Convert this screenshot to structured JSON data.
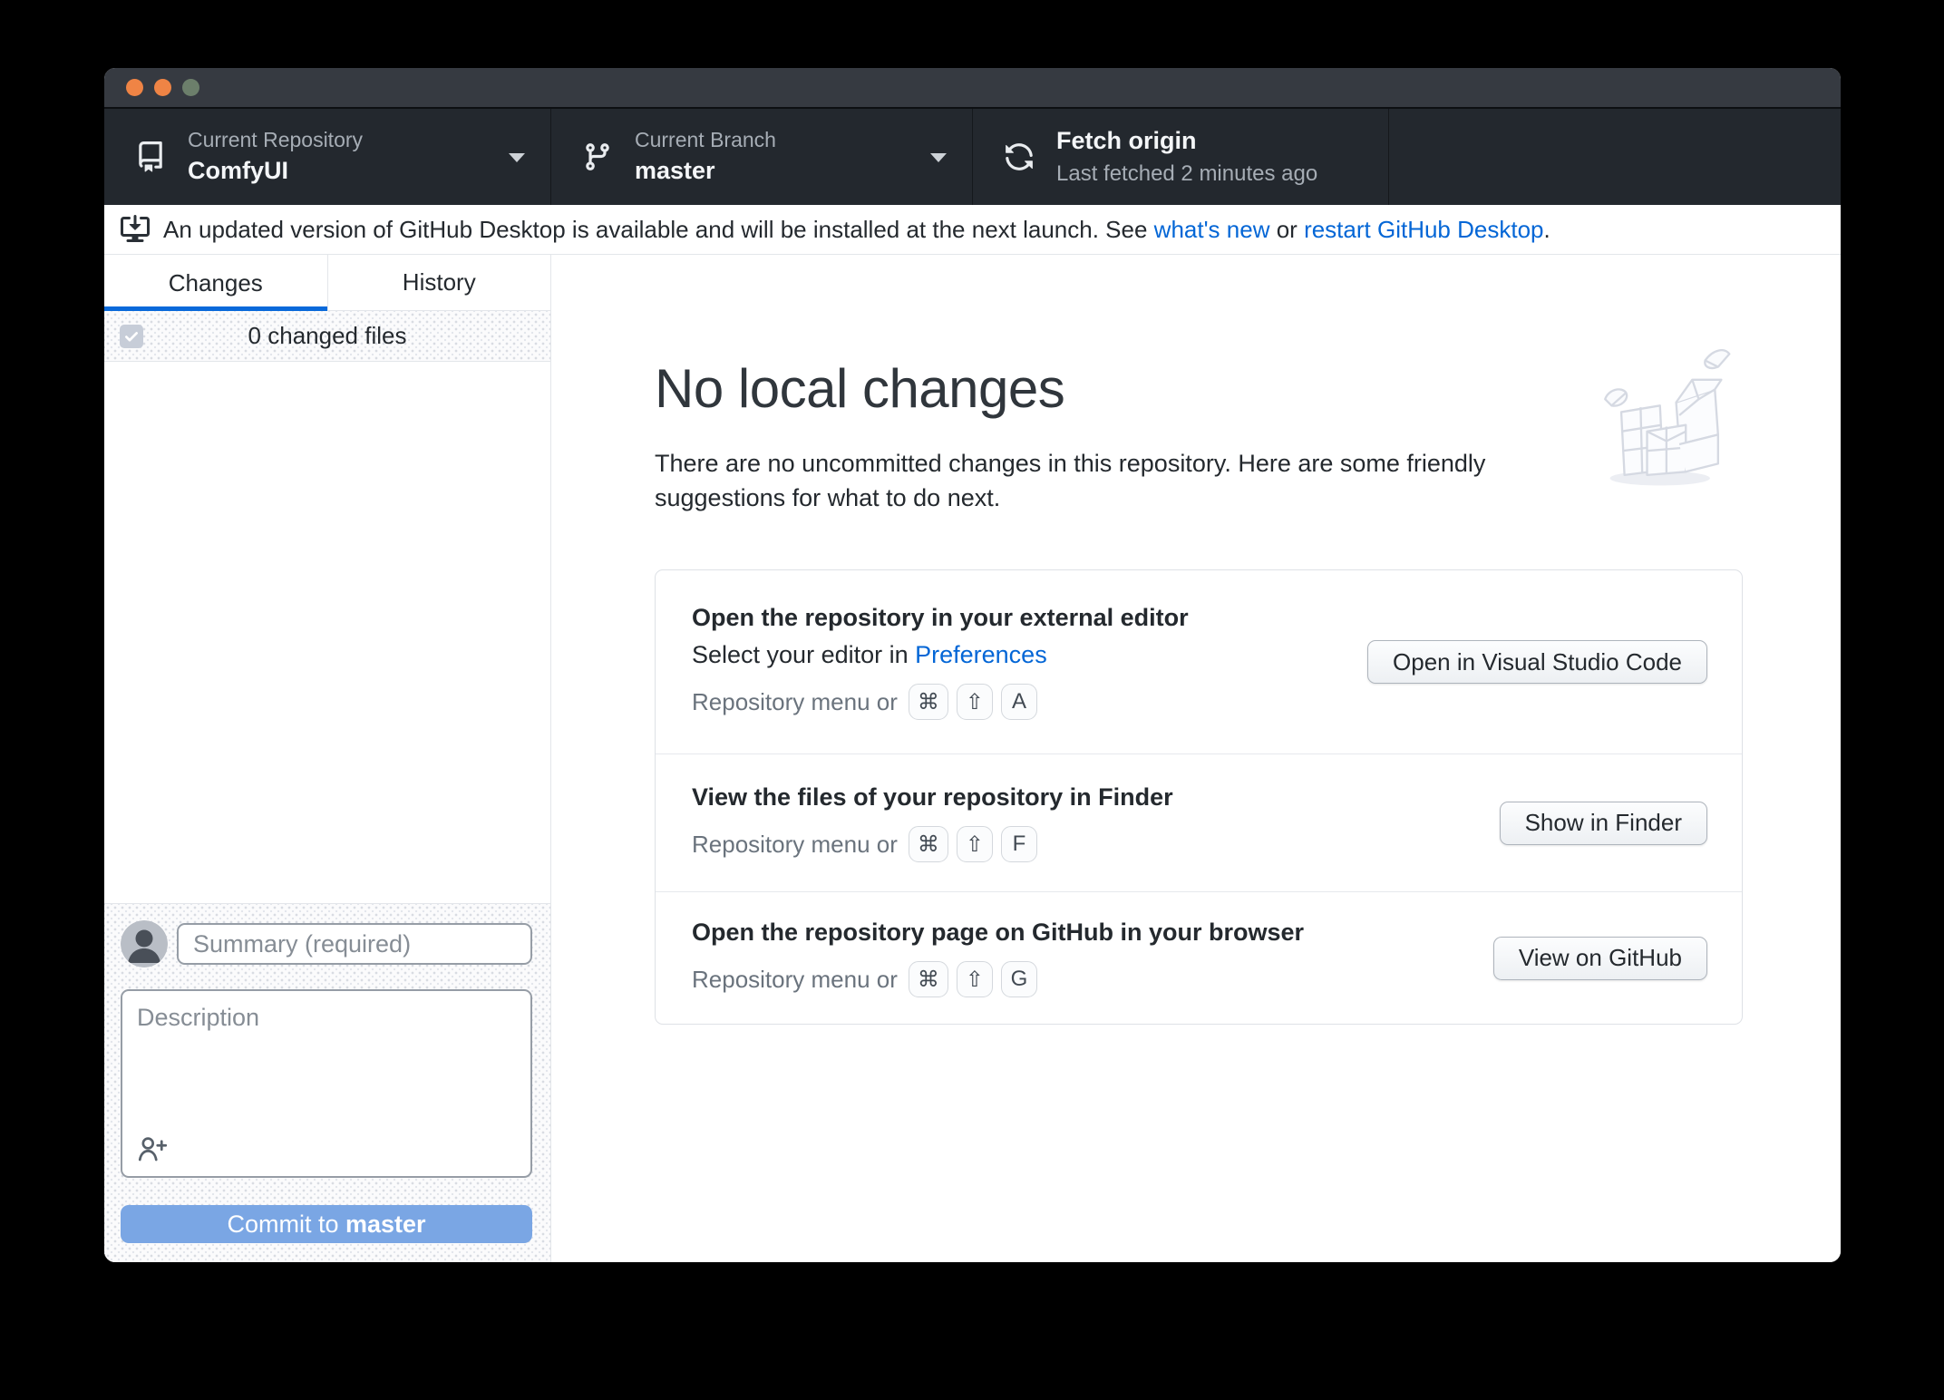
{
  "window": {
    "toolbar": {
      "repository": {
        "label": "Current Repository",
        "value": "ComfyUI"
      },
      "branch": {
        "label": "Current Branch",
        "value": "master"
      },
      "fetch": {
        "title": "Fetch origin",
        "subtitle": "Last fetched 2 minutes ago"
      }
    },
    "banner": {
      "text_before": "An updated version of GitHub Desktop is available and will be installed at the next launch. See ",
      "link_whats_new": "what's new",
      "text_middle": " or ",
      "link_restart": "restart GitHub Desktop",
      "text_after": "."
    },
    "sidebar": {
      "tabs": [
        {
          "label": "Changes",
          "active": true
        },
        {
          "label": "History",
          "active": false
        }
      ],
      "changed_files": {
        "label": "0 changed files",
        "checkbox_checked": true
      },
      "commit_form": {
        "summary_placeholder": "Summary (required)",
        "description_placeholder": "Description",
        "commit_button_prefix": "Commit to ",
        "commit_button_branch": "master"
      }
    },
    "main": {
      "heading": "No local changes",
      "subtext": "There are no uncommitted changes in this repository. Here are some friendly suggestions for what to do next.",
      "suggestions": [
        {
          "title": "Open the repository in your external editor",
          "subtitle_prefix": "Select your editor in ",
          "subtitle_link": "Preferences",
          "shortcut_prefix": "Repository menu or",
          "keys": [
            "⌘",
            "⇧",
            "A"
          ],
          "button": "Open in Visual Studio Code"
        },
        {
          "title": "View the files of your repository in Finder",
          "shortcut_prefix": "Repository menu or",
          "keys": [
            "⌘",
            "⇧",
            "F"
          ],
          "button": "Show in Finder"
        },
        {
          "title": "Open the repository page on GitHub in your browser",
          "shortcut_prefix": "Repository menu or",
          "keys": [
            "⌘",
            "⇧",
            "G"
          ],
          "button": "View on GitHub"
        }
      ]
    },
    "icons": {
      "repo": "book-icon",
      "branch": "git-branch-icon",
      "fetch": "sync-icon",
      "update": "desktop-download-icon",
      "dropdown": "chevron-down-icon",
      "co_author": "person-add-icon",
      "checkbox": "check-icon",
      "empty_state": "crumpled-paper-illustration"
    },
    "colors": {
      "link_blue": "#0366d6",
      "tab_active_blue": "#0969da",
      "commit_button_blue": "#7aa6e4",
      "toolbar_bg": "#23282e",
      "titlebar_bg": "#363a41",
      "traffic_light_orange": "#ef8445",
      "traffic_light_green": "#6c7f6b"
    }
  }
}
